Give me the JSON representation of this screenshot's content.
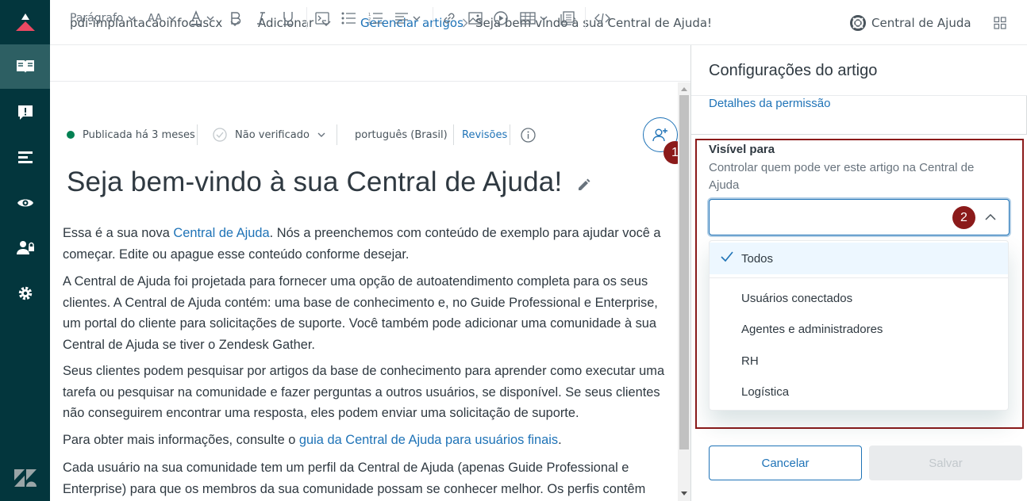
{
  "topbar": {
    "brand_name": "pdi-implantacaoinfocuscx",
    "add_menu": "Adicionar",
    "breadcrumb_link": "Gerenciar artigos",
    "breadcrumb_current": "Seja bem-vindo à sua Central de Ajuda!",
    "help_center_link": "Central de Ajuda"
  },
  "toolbar": {
    "paragraph_label": "Parágrafo",
    "font_size_label": "AA"
  },
  "meta": {
    "status": "Publicada há 3 meses",
    "verification": "Não verificado",
    "language": "português (Brasil)",
    "revisions": "Revisões"
  },
  "article": {
    "title": "Seja bem-vindo à sua Central de Ajuda!",
    "p1_a": "Essa é a sua nova ",
    "p1_link": "Central de Ajuda",
    "p1_b": ". Nós a preenchemos com conteúdo de exemplo para ajudar você a começar. Edite ou apague esse conteúdo conforme desejar.",
    "p2": "A Central de Ajuda foi projetada para fornecer uma opção de autoatendimento completa para os seus clientes. A Central de Ajuda contém: uma base de conhecimento e, no Guide Professional e Enterprise, um portal do cliente para solicitações de suporte. Você também pode adicionar uma comunidade à sua Central de Ajuda se tiver o Zendesk Gather.",
    "p3": "Seus clientes podem pesquisar por artigos da base de conhecimento para aprender como executar uma tarefa ou pesquisar na comunidade e fazer perguntas a outros usuários, se disponível. Se seus clientes não conseguirem encontrar uma resposta, eles podem enviar uma solicitação de suporte.",
    "p4_a": "Para obter mais informações, consulte o ",
    "p4_link": "guia da Central de Ajuda para usuários finais",
    "p4_b": ".",
    "p5": "Cada usuário na sua comunidade tem um perfil da Central de Ajuda (apenas Guide Professional e Enterprise) para que os membros da sua comunidade possam se conhecer melhor. Os perfis contêm"
  },
  "markers": {
    "m1": "1",
    "m2": "2"
  },
  "panel": {
    "title": "Configurações do artigo",
    "permission_details": "Detalhes da permissão",
    "visible_label": "Visível para",
    "visible_hint": "Controlar quem pode ver este artigo na Central de Ajuda",
    "options": [
      "Todos",
      "Usuários conectados",
      "Agentes e administradores",
      "RH",
      "Logística"
    ],
    "selected_option": "Todos",
    "cancel_label": "Cancelar",
    "save_label": "Salvar"
  },
  "colors": {
    "nav_bg": "#03363d",
    "accent": "#1f73b7",
    "marker": "#8b1a1a",
    "status_green": "#038153"
  }
}
